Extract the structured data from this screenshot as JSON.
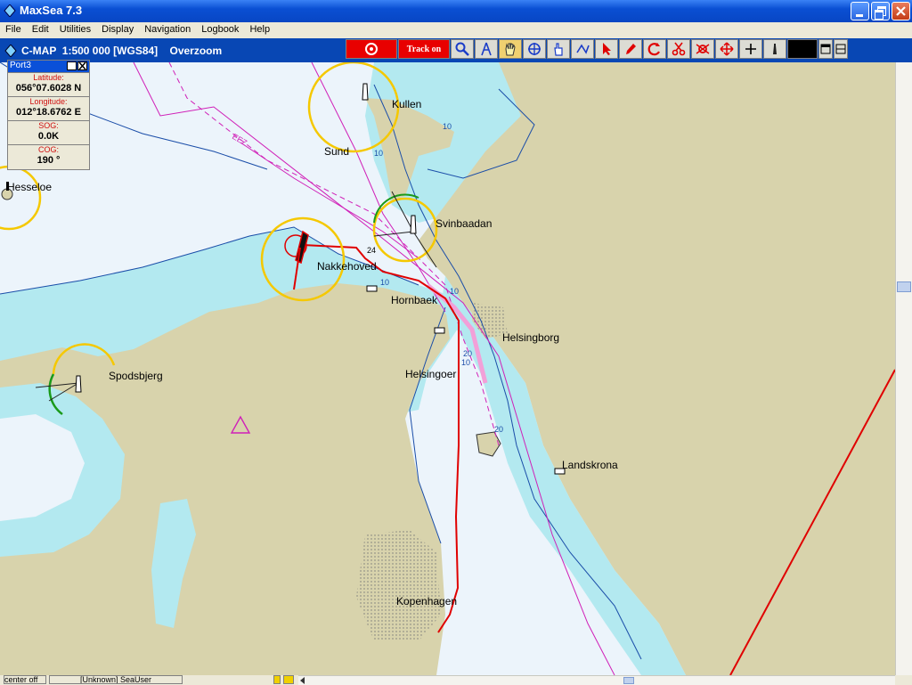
{
  "window": {
    "title": "MaxSea 7.3"
  },
  "menu": [
    "File",
    "Edit",
    "Utilities",
    "Display",
    "Navigation",
    "Logbook",
    "Help"
  ],
  "chart_header": {
    "text": "C-MAP  1:500 000 [WGS84]    Overzoom"
  },
  "toolbar": {
    "track_label": "Track on"
  },
  "port_panel": {
    "title": "Port3",
    "fields": [
      {
        "label": "Latitude:",
        "value": "056°07.6028 N"
      },
      {
        "label": "Longitude:",
        "value": "012°18.6762 E"
      },
      {
        "label": "SOG:",
        "value": "0.0K"
      },
      {
        "label": "COG:",
        "value": "190 °"
      }
    ]
  },
  "places": [
    "Kullen",
    "Sund",
    "Hesseloe",
    "Svinbaadan",
    "Nakkehoved",
    "Hornbaek",
    "Helsingborg",
    "Helsingoer",
    "Spodsbjerg",
    "Landskrona",
    "Kopenhagen"
  ],
  "depth_labels": [
    "10",
    "20",
    "24"
  ],
  "chart_labels": [
    "EEZ"
  ],
  "status": {
    "cell1": "center off",
    "cell2": "[Unknown] SeaUser"
  },
  "colors": {
    "land": "#d8d3ac",
    "shallow": "#b3e9f0",
    "deep": "#ecf4fb",
    "track": "#e00000",
    "range_ring": "#f5c800",
    "boundary": "#d020b8"
  }
}
